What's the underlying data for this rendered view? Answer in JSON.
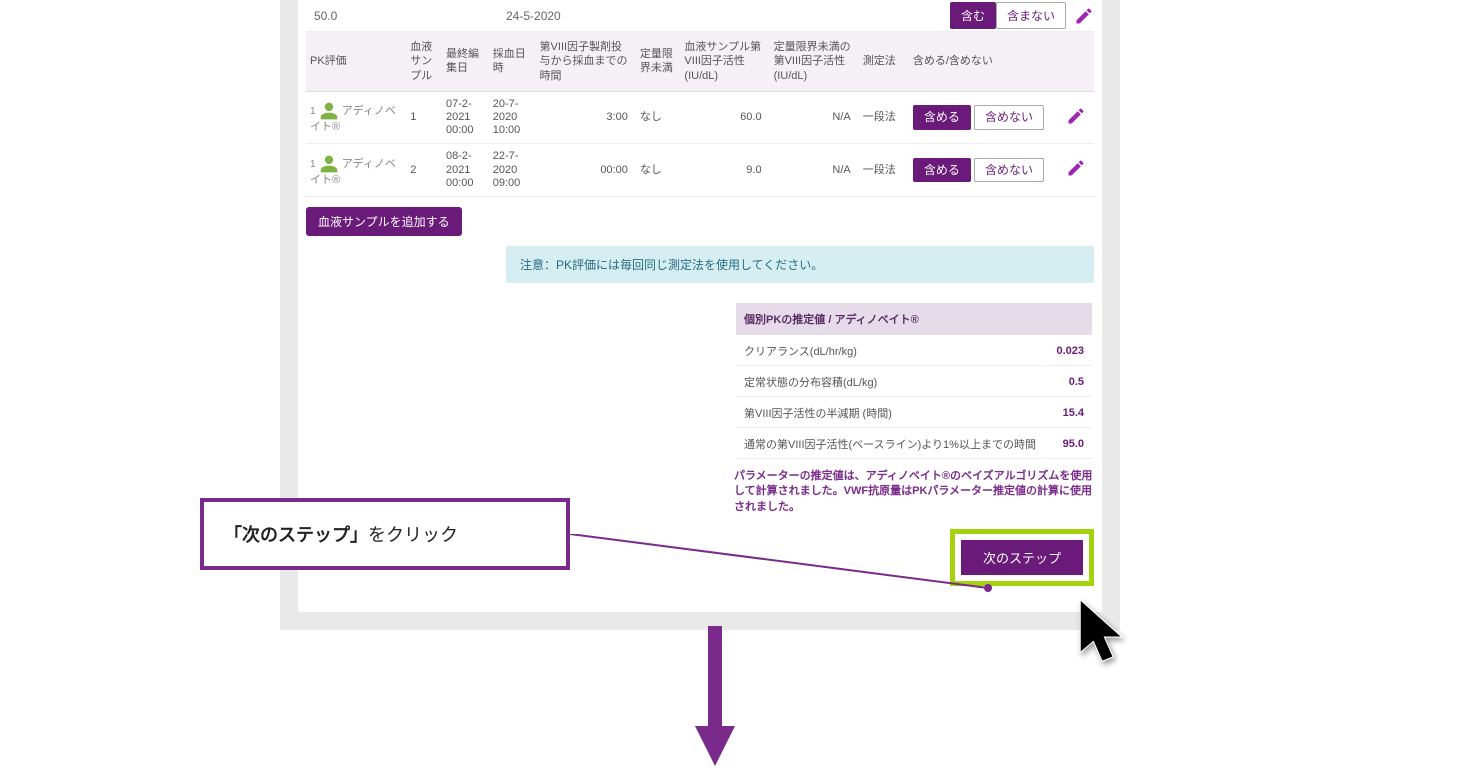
{
  "top": {
    "c1": "50.0",
    "c2": "24-5-2020",
    "include": "含む",
    "exclude": "含まない"
  },
  "headers": {
    "pk": "PK評価",
    "sample": "血液サンプル",
    "editDate": "最終編集日",
    "drawDate": "採血日時",
    "timeSince": "第VIII因子製剤投与から採血までの時間",
    "belowLoq": "定量限界未満",
    "activity": "血液サンプル第VIII因子活性(IU/dL)",
    "activityBelow": "定量限界未満の第VIII因子活性(IU/dL)",
    "assay": "測定法",
    "includeExclude": "含める/含めない"
  },
  "rows": [
    {
      "idx": "1",
      "name": "アディノベイト®",
      "sample": "1",
      "edit": "07-2-2021 00:00",
      "draw": "20-7-2020 10:00",
      "time": "3:00",
      "below": "なし",
      "act": "60.0",
      "actBelow": "N/A",
      "assay": "一段法",
      "inc": "含める",
      "exc": "含めない"
    },
    {
      "idx": "1",
      "name": "アディノベイト®",
      "sample": "2",
      "edit": "08-2-2021 00:00",
      "draw": "22-7-2020 09:00",
      "time": "00:00",
      "below": "なし",
      "act": "9.0",
      "actBelow": "N/A",
      "assay": "一段法",
      "inc": "含める",
      "exc": "含めない"
    }
  ],
  "addSample": "血液サンプルを追加する",
  "note": "注意：PK評価には毎回同じ測定法を使用してください。",
  "summary": {
    "header": "個別PKの推定値 / アディノベイト®",
    "rows": [
      {
        "label": "クリアランス(dL/hr/kg)",
        "val": "0.023"
      },
      {
        "label": "定常状態の分布容積(dL/kg)",
        "val": "0.5"
      },
      {
        "label": "第VIII因子活性の半減期 (時間)",
        "val": "15.4"
      },
      {
        "label": "通常の第VIII因子活性(ベースライン)より1%以上までの時間",
        "val": "95.0"
      }
    ]
  },
  "paramNote": "パラメーターの推定値は、アディノベイト®のベイズアルゴリズムを使用して計算されました。VWF抗原量はPKパラメーター推定値の計算に使用されました。",
  "nextStep": "次のステップ",
  "callout": {
    "bold": "「次のステップ」",
    "rest": "をクリック"
  }
}
